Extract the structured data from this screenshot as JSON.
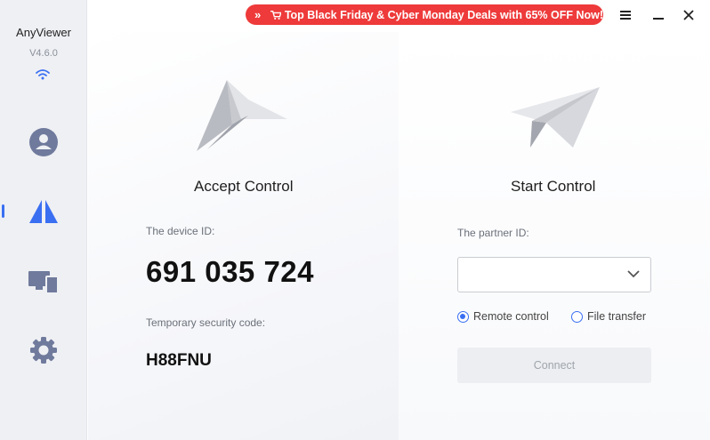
{
  "app": {
    "name": "AnyViewer",
    "version": "V4.6.0"
  },
  "sidebar": {
    "items": [
      {
        "name": "account",
        "icon": "user-icon"
      },
      {
        "name": "remote",
        "icon": "remote-logo-icon",
        "active": true
      },
      {
        "name": "devices",
        "icon": "devices-icon"
      },
      {
        "name": "settings",
        "icon": "gear-icon"
      }
    ]
  },
  "promo": {
    "text": "Top Black Friday & Cyber Monday Deals with 65% OFF Now!"
  },
  "accept": {
    "heading": "Accept Control",
    "device_id_label": "The device ID:",
    "device_id": "691 035 724",
    "security_label": "Temporary security code:",
    "security_code": "H88FNU"
  },
  "start": {
    "heading": "Start Control",
    "partner_label": "The partner ID:",
    "partner_value": "",
    "options": [
      "Remote control",
      "File transfer"
    ],
    "selected_option": "Remote control",
    "connect_label": "Connect"
  },
  "colors": {
    "accent": "#3a6ff2",
    "promo": "#ee3a3a",
    "sidebar": "#eff0f4"
  }
}
